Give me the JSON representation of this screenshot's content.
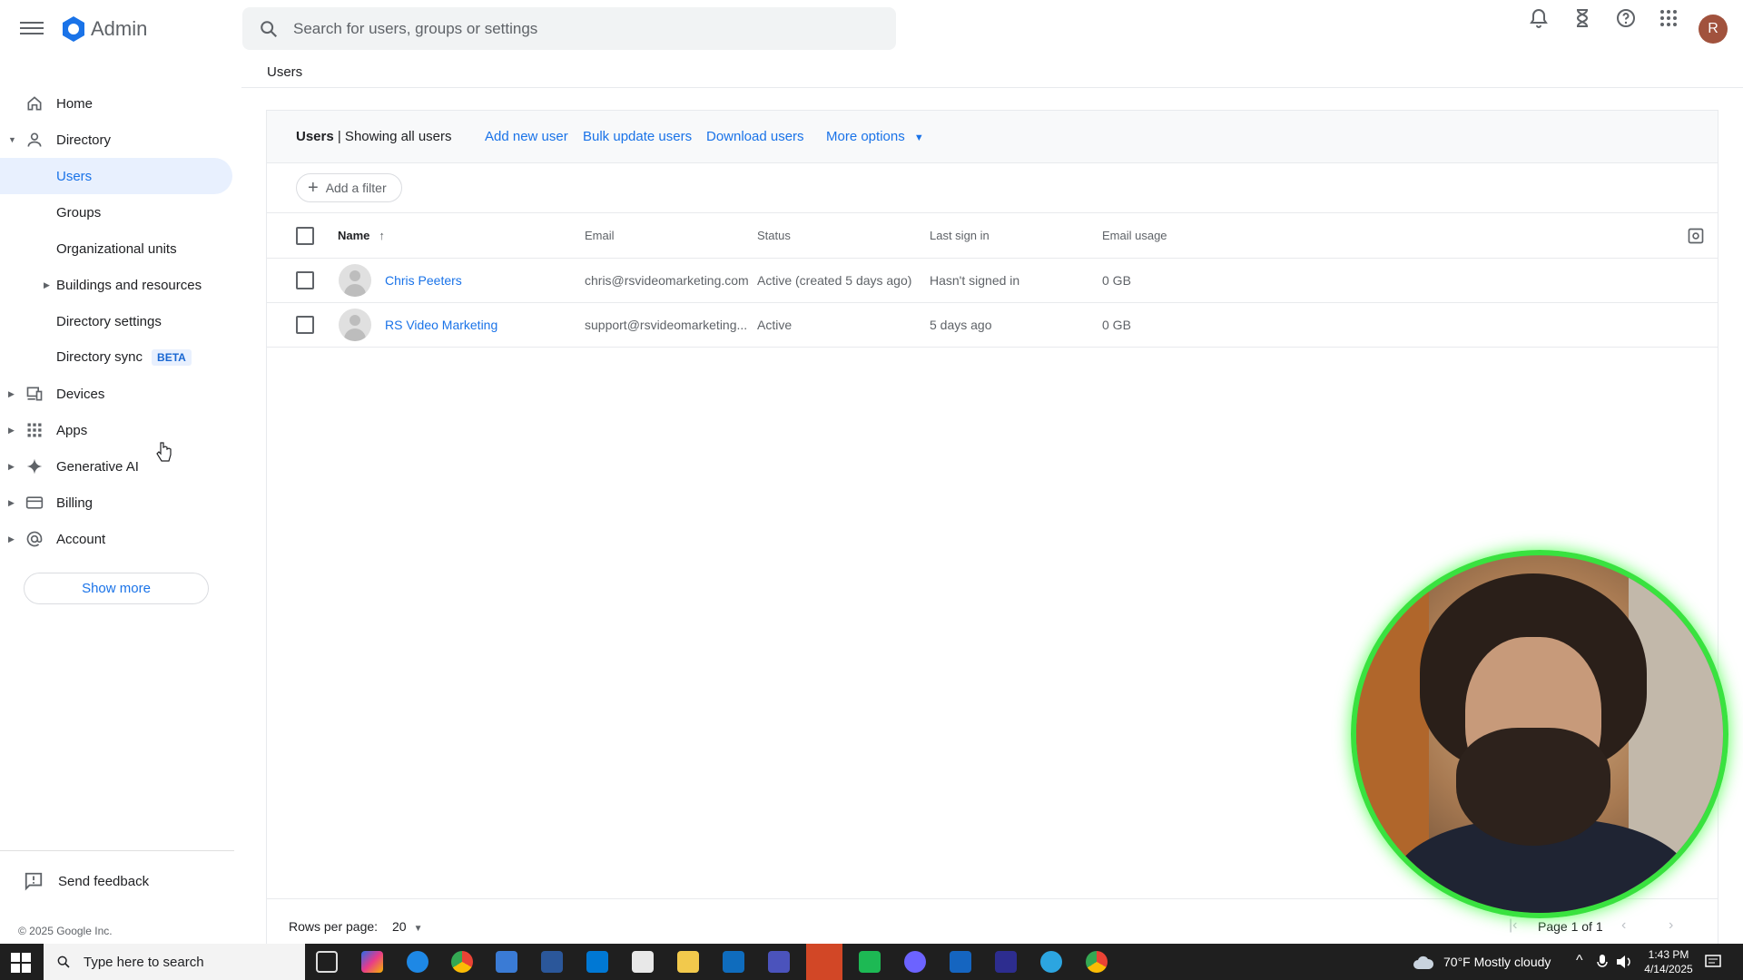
{
  "app": {
    "title": "Admin"
  },
  "search": {
    "placeholder": "Search for users, groups or settings"
  },
  "account": {
    "initial": "R"
  },
  "colors": {
    "accent": "#1a73e8",
    "active_bg": "#e8f0fe",
    "avatar": "#a1523d",
    "webcam_ring": "#39e23f",
    "taskbar": "#1f1f1f"
  },
  "top_icons": [
    "bell-icon",
    "hourglass-icon",
    "help-icon",
    "apps-grid-icon"
  ],
  "sidebar": {
    "items": [
      {
        "label": "Home",
        "icon": "home-icon"
      },
      {
        "label": "Directory",
        "icon": "person-icon",
        "expanded": true
      },
      {
        "label": "Users",
        "active": true
      },
      {
        "label": "Groups"
      },
      {
        "label": "Organizational units"
      },
      {
        "label": "Buildings and resources"
      },
      {
        "label": "Directory settings"
      },
      {
        "label": "Directory sync",
        "badge": "BETA"
      },
      {
        "label": "Devices",
        "icon": "devices-icon"
      },
      {
        "label": "Apps",
        "icon": "apps-grid-icon"
      },
      {
        "label": "Generative AI",
        "icon": "sparkle-icon"
      },
      {
        "label": "Billing",
        "icon": "credit-card-icon"
      },
      {
        "label": "Account",
        "icon": "at-sign-icon"
      }
    ],
    "show_more": "Show more",
    "feedback": "Send feedback",
    "copyright": "© 2025 Google Inc."
  },
  "breadcrumb": "Users",
  "users_panel": {
    "title_bold": "Users",
    "title_rest": " | Showing all users",
    "actions": {
      "add_new_user": "Add new user",
      "bulk_update": "Bulk update users",
      "download": "Download users",
      "more_options": "More options"
    },
    "add_filter": "Add a filter",
    "columns": {
      "name": "Name",
      "email": "Email",
      "status": "Status",
      "last_sign_in": "Last sign in",
      "email_usage": "Email usage"
    },
    "rows": [
      {
        "name": "Chris Peeters",
        "email": "chris@rsvideomarketing.com",
        "status": "Active (created 5 days ago)",
        "last_sign_in": "Hasn't signed in",
        "email_usage": "0 GB"
      },
      {
        "name": "RS Video Marketing",
        "email": "support@rsvideomarketing...",
        "status": "Active",
        "last_sign_in": "5 days ago",
        "email_usage": "0 GB"
      }
    ],
    "footer": {
      "rows_per_page_label": "Rows per page:",
      "rows_per_page_value": "20",
      "page_label": "Page 1 of 1"
    }
  },
  "taskbar": {
    "search_label": "Type here to search",
    "weather": "70°F  Mostly cloudy",
    "time": "1:43 PM",
    "date": "4/14/2025"
  }
}
